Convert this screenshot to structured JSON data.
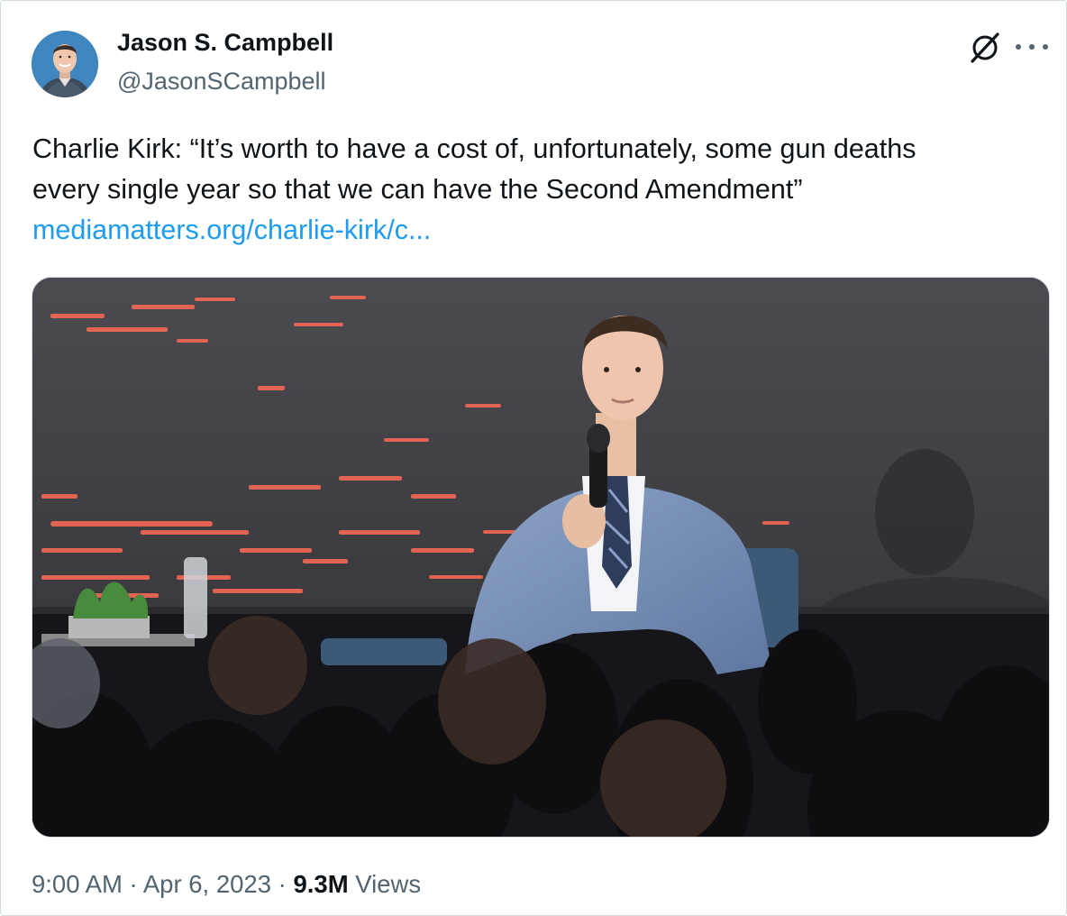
{
  "author": {
    "name": "Jason S. Campbell",
    "handle": "@JasonSCampbell"
  },
  "icons": {
    "grok": "grok-icon",
    "more": "more-options-icon"
  },
  "tweet": {
    "text_line_1": "Charlie Kirk: “It’s worth to have a cost of, unfortunately, some gun deaths",
    "text_line_2": "every single year so that we can have the Second Amendment”",
    "link": "mediamatters.org/charlie-kirk/c..."
  },
  "meta": {
    "time": "9:00 AM",
    "separator": " · ",
    "date": "Apr 6, 2023",
    "views_count": "9.3M",
    "views_label": " Views"
  },
  "colors": {
    "link": "#1d9bf0",
    "secondary_text": "#536471",
    "primary_text": "#0f1419",
    "border": "#cfd9de"
  }
}
